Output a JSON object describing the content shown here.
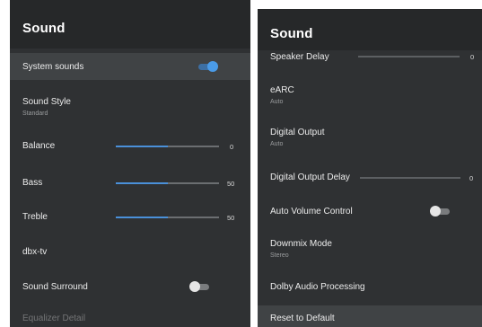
{
  "left": {
    "title": "Sound",
    "items": {
      "system_sounds": {
        "label": "System sounds",
        "state": "on"
      },
      "sound_style": {
        "label": "Sound Style",
        "value": "Standard"
      },
      "balance": {
        "label": "Balance",
        "value": "0",
        "level": 0.5
      },
      "bass": {
        "label": "Bass",
        "value": "50",
        "level": 0.5
      },
      "treble": {
        "label": "Treble",
        "value": "50",
        "level": 0.5
      },
      "dbx": {
        "label": "dbx-tv"
      },
      "surround": {
        "label": "Sound Surround",
        "state": "off"
      },
      "equalizer": {
        "label": "Equalizer Detail"
      }
    }
  },
  "right": {
    "title": "Sound",
    "items": {
      "speaker_delay": {
        "label": "Speaker Delay",
        "value": "0"
      },
      "earc": {
        "label": "eARC",
        "value": "Auto"
      },
      "digital_output": {
        "label": "Digital Output",
        "value": "Auto"
      },
      "digital_output_delay": {
        "label": "Digital Output Delay",
        "value": "0"
      },
      "auto_volume": {
        "label": "Auto Volume Control",
        "state": "off"
      },
      "downmix": {
        "label": "Downmix Mode",
        "value": "Stereo"
      },
      "dolby": {
        "label": "Dolby Audio Processing"
      },
      "reset": {
        "label": "Reset to Default"
      }
    }
  },
  "colors": {
    "panel_bg": "#2f3133",
    "header_bg": "#262829",
    "highlight_bg": "#404345",
    "accent": "#4a90d9"
  }
}
